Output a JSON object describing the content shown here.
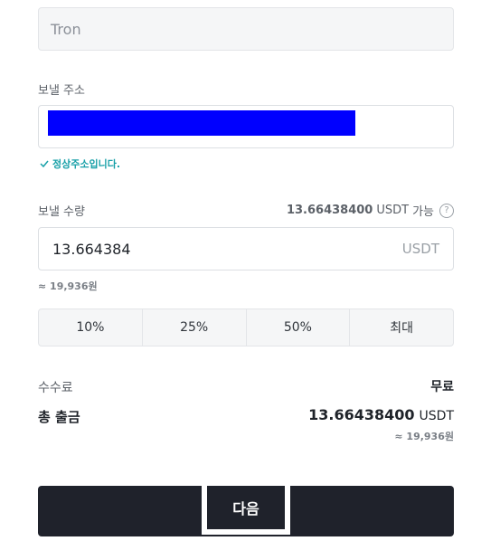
{
  "network": {
    "value": "Tron"
  },
  "address": {
    "label": "보낼 주소",
    "valid_message": "정상주소입니다.",
    "redaction_color": "#0000ff"
  },
  "quantity": {
    "label": "보낼 수량",
    "available_amount": "13.66438400",
    "available_unit": "USDT",
    "available_suffix": "가능",
    "help_icon": "?",
    "value": "13.664384",
    "unit": "USDT",
    "krw_approx": "≈ 19,936원"
  },
  "percent_buttons": [
    "10%",
    "25%",
    "50%",
    "최대"
  ],
  "fee": {
    "label": "수수료",
    "value": "무료"
  },
  "total": {
    "label": "총 출금",
    "amount": "13.66438400",
    "unit": "USDT",
    "krw_approx": "≈ 19,936원"
  },
  "next_button": {
    "label": "다음"
  },
  "colors": {
    "accent_teal": "#18a0a8",
    "button_dark": "#1f222b"
  }
}
